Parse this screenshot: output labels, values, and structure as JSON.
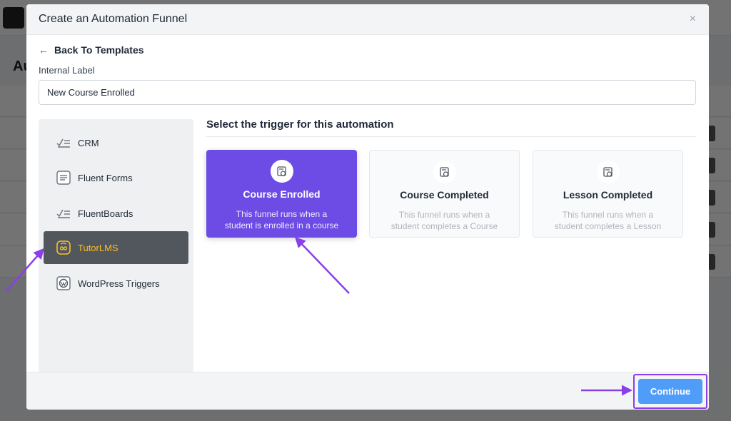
{
  "modal": {
    "title": "Create an Automation Funnel",
    "close_glyph": "×",
    "back_link": "Back To Templates",
    "back_arrow": "←",
    "internal_label": "Internal Label",
    "internal_label_value": "New Course Enrolled"
  },
  "sidebar": {
    "items": [
      {
        "label": "CRM",
        "icon": "check-lines-icon",
        "active": false
      },
      {
        "label": "Fluent Forms",
        "icon": "form-icon",
        "active": false
      },
      {
        "label": "FluentBoards",
        "icon": "check-lines-icon",
        "active": false
      },
      {
        "label": "TutorLMS",
        "icon": "tutor-icon",
        "active": true
      },
      {
        "label": "WordPress Triggers",
        "icon": "wordpress-icon",
        "active": false
      }
    ]
  },
  "trigger": {
    "heading": "Select the trigger for this automation",
    "cards": [
      {
        "title": "Course Enrolled",
        "desc": "This funnel runs when a student is enrolled in a course",
        "selected": true
      },
      {
        "title": "Course Completed",
        "desc": "This funnel runs when a student completes a Course",
        "selected": false
      },
      {
        "title": "Lesson Completed",
        "desc": "This funnel runs when a student completes a Lesson",
        "selected": false
      }
    ]
  },
  "footer": {
    "continue_label": "Continue"
  },
  "background": {
    "page_title_fragment": "Au"
  },
  "colors": {
    "accent_purple": "#6d4ce6",
    "active_sidebar": "#52575e",
    "tutor_yellow": "#fbbf24",
    "continue_blue": "#4f9cf9",
    "annotation_purple": "#8b3fe8"
  }
}
